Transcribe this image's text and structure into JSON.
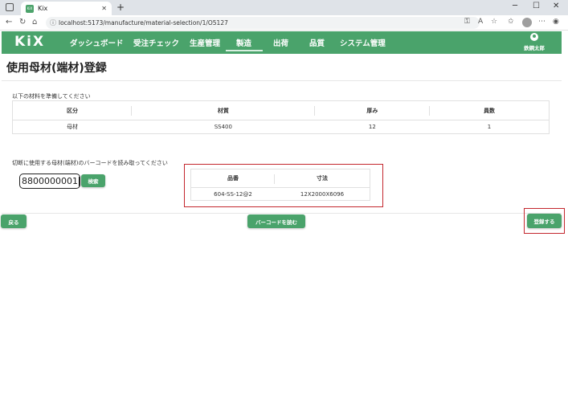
{
  "browser": {
    "tab_title": "Kix",
    "favicon_text": "KiX",
    "url": "localhost:5173/manufacture/material-selection/1/O5127"
  },
  "app": {
    "logo": "KiX",
    "nav": [
      "ダッシュボード",
      "受注チェック",
      "生産管理",
      "製造",
      "出荷",
      "品質",
      "システム管理"
    ],
    "active_nav": "製造",
    "user_name": "鉄鋼太郎"
  },
  "page": {
    "title": "使用母材(端材)登録",
    "instruction_materials": "以下の材料を準備してください",
    "instruction_barcode": "切断に使用する母材(端材)のバーコードを読み取ってください"
  },
  "materials_table": {
    "headers": [
      "区分",
      "材質",
      "厚み",
      "員数"
    ],
    "rows": [
      [
        "母材",
        "SS400",
        "12",
        "1"
      ]
    ]
  },
  "barcode": {
    "value": "8800000001",
    "search_button": "検索"
  },
  "result_table": {
    "headers": [
      "品番",
      "寸法"
    ],
    "rows": [
      [
        "604-SS-12@2",
        "12X2000X6096"
      ]
    ]
  },
  "actions": {
    "back": "戻る",
    "read_barcode": "バーコードを読む",
    "register": "登録する"
  },
  "colors": {
    "brand": "#4aa36b",
    "highlight": "#c3262d"
  }
}
